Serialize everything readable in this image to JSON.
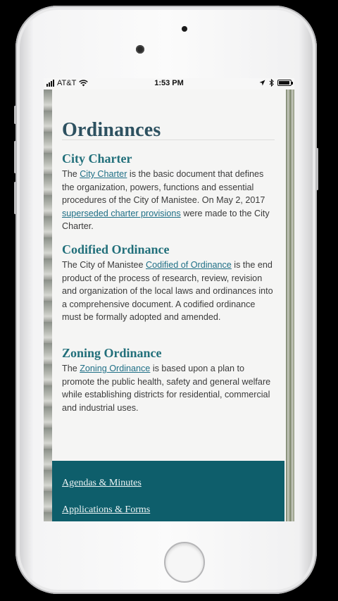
{
  "status_bar": {
    "carrier": "AT&T",
    "time": "1:53 PM"
  },
  "page": {
    "title": "Ordinances",
    "sections": [
      {
        "heading": "City Charter",
        "body": [
          {
            "t": "The "
          },
          {
            "t": "City Charter",
            "link": true
          },
          {
            "t": " is the basic document that defines the organization, powers, functions and essential procedures of the City of Manistee. On May 2, 2017 "
          },
          {
            "t": "superseded charter provisions",
            "link": true
          },
          {
            "t": " were made to the City Charter."
          }
        ]
      },
      {
        "heading": "Codified Ordinance",
        "body": [
          {
            "t": "The City of Manistee "
          },
          {
            "t": "Codified of Ordinance",
            "link": true
          },
          {
            "t": " is the end product of the process of research, review, revision and organization of the local laws and ordinances into a comprehensive document. A codified ordinance must be formally adopted and amended."
          }
        ]
      },
      {
        "heading": "Zoning Ordinance",
        "body": [
          {
            "t": "The "
          },
          {
            "t": "Zoning Ordinance",
            "link": true
          },
          {
            "t": " is based upon a plan to promote the public health, safety and general welfare while establishing districts for residential, commercial and industrial uses."
          }
        ]
      }
    ]
  },
  "footer_nav": {
    "items": [
      "Agendas & Minutes",
      "Applications & Forms"
    ]
  },
  "colors": {
    "heading": "#216f7a",
    "title": "#2d5160",
    "link": "#1f6f86",
    "footer_bg": "#0e5e6b"
  }
}
